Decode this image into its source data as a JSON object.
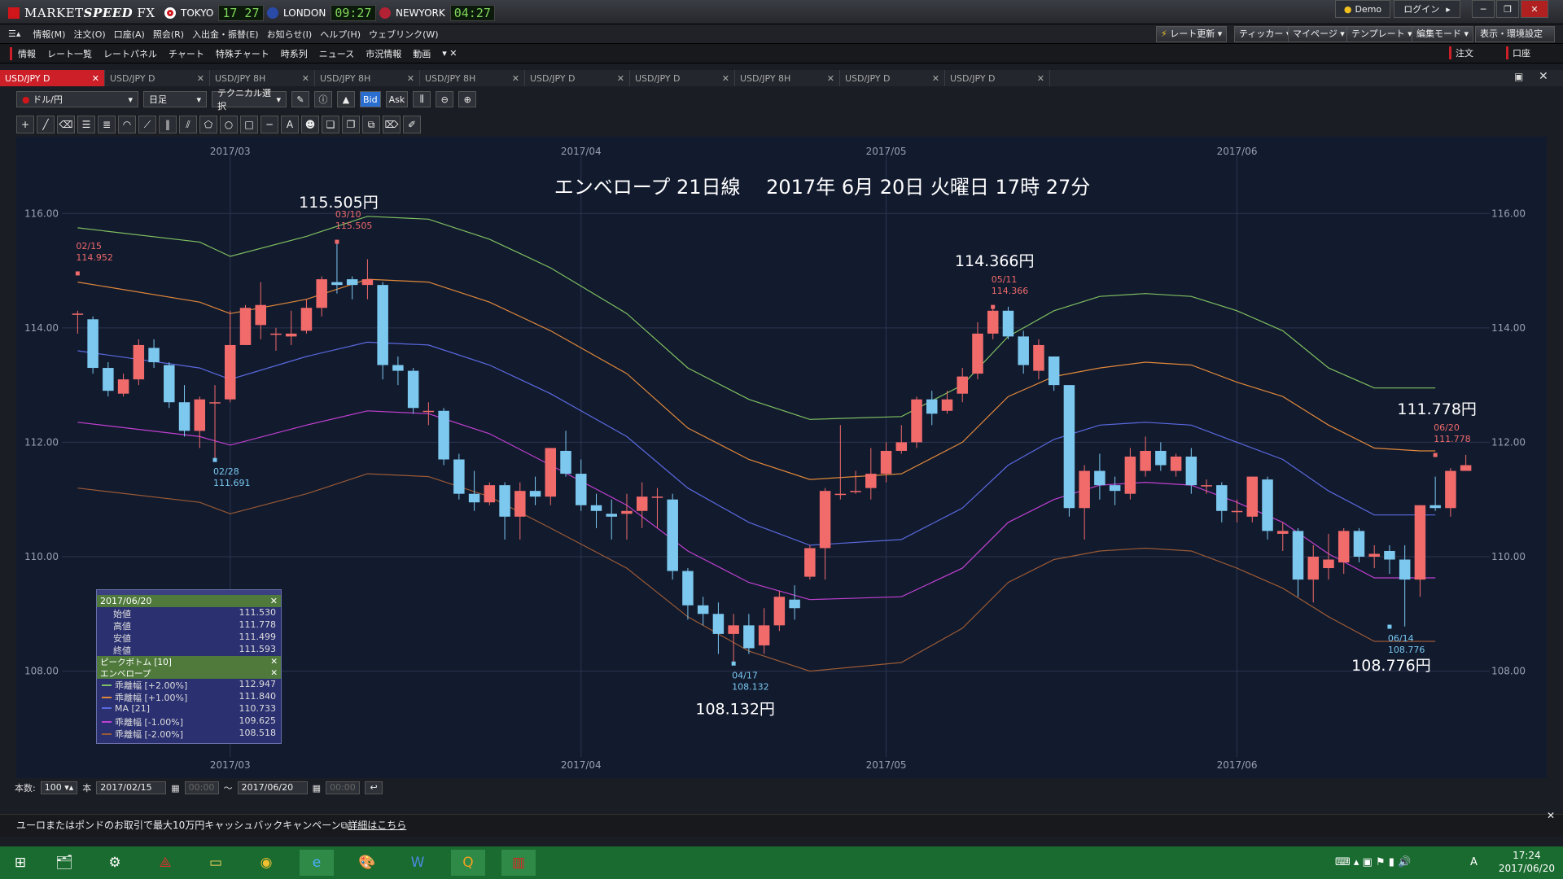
{
  "app": {
    "name_a": "MARKET",
    "name_b": "SPEED",
    "name_c": " FX"
  },
  "clocks": [
    {
      "city": "TOKYO",
      "time": "17 27",
      "flag": "#d0151b"
    },
    {
      "city": "LONDON",
      "time": "09:27",
      "flag": "#2a4aa8"
    },
    {
      "city": "NEWYORK",
      "time": "04:27",
      "flag": "#b22234"
    }
  ],
  "window": {
    "demo": "Demo",
    "login": "ログイン"
  },
  "menu": [
    "情報(M)",
    "注文(O)",
    "口座(A)",
    "照会(R)",
    "入出金・振替(E)",
    "お知らせ(I)",
    "ヘルプ(H)",
    "ウェブリンク(W)"
  ],
  "right_menu": [
    "レート更新",
    "ティッカー",
    "マイページ",
    "テンプレート",
    "編集モード",
    "表示・環境設定"
  ],
  "nav": [
    "情報",
    "レート一覧",
    "レートパネル",
    "チャート",
    "特殊チャート",
    "時系列",
    "ニュース",
    "市況情報",
    "動画"
  ],
  "nav_right": [
    "注文",
    "口座"
  ],
  "tabs": [
    "USD/JPY D",
    "USD/JPY D",
    "USD/JPY 8H",
    "USD/JPY 8H",
    "USD/JPY 8H",
    "USD/JPY D",
    "USD/JPY D",
    "USD/JPY 8H",
    "USD/JPY D",
    "USD/JPY D"
  ],
  "toolbar": {
    "pair": "ドル/円",
    "period": "日足",
    "tech": "テクニカル選択",
    "bid": "Bid",
    "ask": "Ask"
  },
  "chart_data": {
    "type": "candlestick",
    "title": "エンベロープ 21日線　 2017年 6月 20日 火曜日 17時 27分",
    "ylim": [
      106.5,
      117.0
    ],
    "yticks": [
      "116.00",
      "114.00",
      "112.00",
      "110.00",
      "108.00"
    ],
    "ytick_values": [
      116,
      114,
      112,
      110,
      108
    ],
    "month_labels": [
      {
        "label": "2017/03",
        "d": 10
      },
      {
        "label": "2017/04",
        "d": 33
      },
      {
        "label": "2017/05",
        "d": 53
      },
      {
        "label": "2017/06",
        "d": 76
      }
    ],
    "candles": [
      [
        114.25,
        114.25,
        114.3,
        113.9
      ],
      [
        114.15,
        113.3,
        114.2,
        113.2
      ],
      [
        113.3,
        112.9,
        113.4,
        112.8
      ],
      [
        112.85,
        113.1,
        113.2,
        112.8
      ],
      [
        113.1,
        113.7,
        113.8,
        113.0
      ],
      [
        113.65,
        113.4,
        113.8,
        113.3
      ],
      [
        113.35,
        112.7,
        113.4,
        112.6
      ],
      [
        112.7,
        112.2,
        113.0,
        112.1
      ],
      [
        112.2,
        112.75,
        112.8,
        111.9
      ],
      [
        112.7,
        112.7,
        113.0,
        111.7
      ],
      [
        112.75,
        113.7,
        114.3,
        112.7
      ],
      [
        113.7,
        114.35,
        114.4,
        113.7
      ],
      [
        114.05,
        114.4,
        114.8,
        113.8
      ],
      [
        113.9,
        113.9,
        114.0,
        113.6
      ],
      [
        113.85,
        113.9,
        114.3,
        113.7
      ],
      [
        113.95,
        114.35,
        114.5,
        113.9
      ],
      [
        114.35,
        114.85,
        114.9,
        114.2
      ],
      [
        114.8,
        114.75,
        115.5,
        114.6
      ],
      [
        114.85,
        114.75,
        114.9,
        114.5
      ],
      [
        114.75,
        114.85,
        115.2,
        114.5
      ],
      [
        114.75,
        113.35,
        114.8,
        113.1
      ],
      [
        113.35,
        113.25,
        113.5,
        113.0
      ],
      [
        113.25,
        112.6,
        113.3,
        112.5
      ],
      [
        112.55,
        112.55,
        112.7,
        112.3
      ],
      [
        112.55,
        111.7,
        112.6,
        111.6
      ],
      [
        111.7,
        111.1,
        111.8,
        111.0
      ],
      [
        111.1,
        110.95,
        111.5,
        110.8
      ],
      [
        110.95,
        111.25,
        111.3,
        110.9
      ],
      [
        111.25,
        110.7,
        111.3,
        110.3
      ],
      [
        110.7,
        111.15,
        111.3,
        110.3
      ],
      [
        111.15,
        111.05,
        111.4,
        110.9
      ],
      [
        111.05,
        111.9,
        111.9,
        110.9
      ],
      [
        111.85,
        111.45,
        112.2,
        111.4
      ],
      [
        111.45,
        110.9,
        111.7,
        110.8
      ],
      [
        110.9,
        110.8,
        111.1,
        110.5
      ],
      [
        110.75,
        110.7,
        111.0,
        110.3
      ],
      [
        110.75,
        110.8,
        111.1,
        110.3
      ],
      [
        110.8,
        111.05,
        111.3,
        110.5
      ],
      [
        111.05,
        111.05,
        111.2,
        110.5
      ],
      [
        111.0,
        109.75,
        111.1,
        109.6
      ],
      [
        109.75,
        109.15,
        109.8,
        108.9
      ],
      [
        109.15,
        109.0,
        109.3,
        108.8
      ],
      [
        109.0,
        108.65,
        109.2,
        108.3
      ],
      [
        108.65,
        108.8,
        109.0,
        108.13
      ],
      [
        108.8,
        108.4,
        109.0,
        108.3
      ],
      [
        108.45,
        108.8,
        109.1,
        108.3
      ],
      [
        108.8,
        109.3,
        109.4,
        108.7
      ],
      [
        109.25,
        109.1,
        109.5,
        108.9
      ],
      [
        109.65,
        110.15,
        110.2,
        109.6
      ],
      [
        110.15,
        111.15,
        111.2,
        109.6
      ],
      [
        111.1,
        111.1,
        112.3,
        111.0
      ],
      [
        111.15,
        111.15,
        111.5,
        111.1
      ],
      [
        111.2,
        111.45,
        111.9,
        111.0
      ],
      [
        111.45,
        111.85,
        112.0,
        111.3
      ],
      [
        111.85,
        112.0,
        112.3,
        111.8
      ],
      [
        112.0,
        112.75,
        112.8,
        111.9
      ],
      [
        112.75,
        112.5,
        112.9,
        112.3
      ],
      [
        112.55,
        112.75,
        112.9,
        112.5
      ],
      [
        112.85,
        113.15,
        113.3,
        112.7
      ],
      [
        113.2,
        113.9,
        114.1,
        113.1
      ],
      [
        113.9,
        114.3,
        114.37,
        113.8
      ],
      [
        114.3,
        113.85,
        114.37,
        113.8
      ],
      [
        113.85,
        113.35,
        113.95,
        113.2
      ],
      [
        113.25,
        113.7,
        113.8,
        113.1
      ],
      [
        113.5,
        113.0,
        113.5,
        112.9
      ],
      [
        113.0,
        110.85,
        113.0,
        110.7
      ],
      [
        110.85,
        111.5,
        111.6,
        110.3
      ],
      [
        111.5,
        111.25,
        111.8,
        111.0
      ],
      [
        111.25,
        111.15,
        111.4,
        110.9
      ],
      [
        111.1,
        111.75,
        111.9,
        111.0
      ],
      [
        111.5,
        111.85,
        112.1,
        111.4
      ],
      [
        111.85,
        111.6,
        112.0,
        111.5
      ],
      [
        111.5,
        111.75,
        111.8,
        111.4
      ],
      [
        111.75,
        111.25,
        111.9,
        111.1
      ],
      [
        111.25,
        111.25,
        111.35,
        111.1
      ],
      [
        111.25,
        110.8,
        111.3,
        110.6
      ],
      [
        110.8,
        110.8,
        111.0,
        110.6
      ],
      [
        110.7,
        111.4,
        111.4,
        110.6
      ],
      [
        111.35,
        110.45,
        111.4,
        110.3
      ],
      [
        110.4,
        110.45,
        110.6,
        110.1
      ],
      [
        110.45,
        109.6,
        110.5,
        109.3
      ],
      [
        109.6,
        110.0,
        110.2,
        109.2
      ],
      [
        109.8,
        109.95,
        110.4,
        109.6
      ],
      [
        109.9,
        110.45,
        110.5,
        109.7
      ],
      [
        110.45,
        110.0,
        110.5,
        109.9
      ],
      [
        110.0,
        110.05,
        110.2,
        109.8
      ],
      [
        110.1,
        109.95,
        110.2,
        109.7
      ],
      [
        109.95,
        109.6,
        110.2,
        108.78
      ],
      [
        109.6,
        110.9,
        110.9,
        109.3
      ],
      [
        110.9,
        110.85,
        111.4,
        110.8
      ],
      [
        110.85,
        111.5,
        111.55,
        110.7
      ],
      [
        111.5,
        111.6,
        111.78,
        111.5
      ]
    ],
    "envelopes": [
      {
        "name": "乖離幅 [+2.00%]",
        "color": "#7fc060",
        "pts": [
          [
            0,
            115.75
          ],
          [
            8,
            115.5
          ],
          [
            10,
            115.25
          ],
          [
            15,
            115.6
          ],
          [
            19,
            115.95
          ],
          [
            23,
            115.9
          ],
          [
            27,
            115.55
          ],
          [
            31,
            115.05
          ],
          [
            36,
            114.25
          ],
          [
            40,
            113.3
          ],
          [
            44,
            112.75
          ],
          [
            48,
            112.4
          ],
          [
            54,
            112.45
          ],
          [
            58,
            113.0
          ],
          [
            61,
            113.85
          ],
          [
            64,
            114.3
          ],
          [
            67,
            114.55
          ],
          [
            70,
            114.6
          ],
          [
            73,
            114.55
          ],
          [
            76,
            114.3
          ],
          [
            79,
            113.95
          ],
          [
            82,
            113.3
          ],
          [
            85,
            112.95
          ],
          [
            89,
            112.95
          ]
        ]
      },
      {
        "name": "乖離幅 [+1.00%]",
        "color": "#e0883a",
        "pts": [
          [
            0,
            114.8
          ],
          [
            8,
            114.45
          ],
          [
            10,
            114.25
          ],
          [
            15,
            114.5
          ],
          [
            19,
            114.85
          ],
          [
            23,
            114.8
          ],
          [
            27,
            114.45
          ],
          [
            31,
            113.95
          ],
          [
            36,
            113.2
          ],
          [
            40,
            112.25
          ],
          [
            44,
            111.7
          ],
          [
            48,
            111.35
          ],
          [
            54,
            111.45
          ],
          [
            58,
            112.0
          ],
          [
            61,
            112.8
          ],
          [
            64,
            113.15
          ],
          [
            67,
            113.3
          ],
          [
            70,
            113.4
          ],
          [
            73,
            113.35
          ],
          [
            76,
            113.05
          ],
          [
            79,
            112.8
          ],
          [
            82,
            112.3
          ],
          [
            85,
            111.9
          ],
          [
            88,
            111.85
          ],
          [
            89,
            111.85
          ]
        ]
      },
      {
        "name": "MA [21]",
        "color": "#5a6adf",
        "pts": [
          [
            0,
            113.6
          ],
          [
            8,
            113.3
          ],
          [
            10,
            113.1
          ],
          [
            15,
            113.5
          ],
          [
            19,
            113.75
          ],
          [
            23,
            113.7
          ],
          [
            27,
            113.35
          ],
          [
            31,
            112.85
          ],
          [
            36,
            112.1
          ],
          [
            40,
            111.2
          ],
          [
            44,
            110.6
          ],
          [
            48,
            110.2
          ],
          [
            54,
            110.3
          ],
          [
            58,
            110.85
          ],
          [
            61,
            111.6
          ],
          [
            64,
            112.05
          ],
          [
            67,
            112.3
          ],
          [
            70,
            112.35
          ],
          [
            73,
            112.3
          ],
          [
            76,
            112.0
          ],
          [
            79,
            111.7
          ],
          [
            82,
            111.15
          ],
          [
            85,
            110.73
          ],
          [
            89,
            110.73
          ]
        ]
      },
      {
        "name": "乖離幅 [-1.00%]",
        "color": "#c040d0",
        "pts": [
          [
            0,
            112.35
          ],
          [
            8,
            112.1
          ],
          [
            10,
            111.95
          ],
          [
            15,
            112.3
          ],
          [
            19,
            112.55
          ],
          [
            23,
            112.5
          ],
          [
            27,
            112.15
          ],
          [
            31,
            111.6
          ],
          [
            36,
            110.9
          ],
          [
            40,
            110.1
          ],
          [
            44,
            109.55
          ],
          [
            48,
            109.25
          ],
          [
            54,
            109.3
          ],
          [
            58,
            109.8
          ],
          [
            61,
            110.6
          ],
          [
            64,
            111.0
          ],
          [
            67,
            111.25
          ],
          [
            70,
            111.3
          ],
          [
            73,
            111.25
          ],
          [
            76,
            110.95
          ],
          [
            79,
            110.6
          ],
          [
            82,
            110.05
          ],
          [
            85,
            109.63
          ],
          [
            89,
            109.63
          ]
        ]
      },
      {
        "name": "乖離幅 [-2.00%]",
        "color": "#9a5a34",
        "pts": [
          [
            0,
            111.2
          ],
          [
            8,
            110.95
          ],
          [
            10,
            110.75
          ],
          [
            15,
            111.1
          ],
          [
            19,
            111.45
          ],
          [
            23,
            111.4
          ],
          [
            27,
            111.05
          ],
          [
            31,
            110.5
          ],
          [
            36,
            109.8
          ],
          [
            40,
            108.95
          ],
          [
            44,
            108.35
          ],
          [
            48,
            108.0
          ],
          [
            54,
            108.15
          ],
          [
            58,
            108.75
          ],
          [
            61,
            109.55
          ],
          [
            64,
            109.95
          ],
          [
            67,
            110.1
          ],
          [
            70,
            110.15
          ],
          [
            73,
            110.1
          ],
          [
            76,
            109.8
          ],
          [
            79,
            109.45
          ],
          [
            82,
            108.95
          ],
          [
            85,
            108.52
          ],
          [
            89,
            108.52
          ]
        ]
      }
    ],
    "markers": [
      {
        "i": 0,
        "date": "02/15",
        "price": "114.952",
        "v": 114.952,
        "pos": "above",
        "color": "#ef6a6a"
      },
      {
        "i": 9,
        "date": "02/28",
        "price": "111.691",
        "v": 111.691,
        "pos": "below",
        "color": "#78c8f0"
      },
      {
        "i": 17,
        "date": "03/10",
        "price": "115.505",
        "v": 115.505,
        "pos": "above",
        "color": "#ef6a6a"
      },
      {
        "i": 43,
        "date": "04/17",
        "price": "108.132",
        "v": 108.132,
        "pos": "below",
        "color": "#78c8f0"
      },
      {
        "i": 60,
        "date": "05/11",
        "price": "114.366",
        "v": 114.366,
        "pos": "above",
        "color": "#ef6a6a"
      },
      {
        "i": 86,
        "date": "06/14",
        "price": "108.776",
        "v": 108.776,
        "pos": "below",
        "color": "#78c8f0"
      },
      {
        "i": 89,
        "date": "06/20",
        "price": "111.778",
        "v": 111.778,
        "pos": "above",
        "color": "#ef6a6a"
      }
    ],
    "big_labels": [
      {
        "text": "115.505円",
        "i": 17,
        "v": 115.505,
        "pos": "above"
      },
      {
        "text": "114.366円",
        "i": 60,
        "v": 114.366,
        "pos": "above2"
      },
      {
        "text": "111.778円",
        "i": 89,
        "v": 111.778,
        "pos": "above2"
      },
      {
        "text": "108.776円",
        "i": 86,
        "v": 108.776,
        "pos": "below"
      },
      {
        "text": "108.132円",
        "i": 43,
        "v": 108.132,
        "pos": "below2"
      }
    ]
  },
  "infobox": {
    "date": "2017/06/20",
    "ohlc": [
      {
        "k": "始値",
        "v": "111.530"
      },
      {
        "k": "高値",
        "v": "111.778"
      },
      {
        "k": "安値",
        "v": "111.499"
      },
      {
        "k": "終値",
        "v": "111.593"
      }
    ],
    "peak": "ピークボトム [10]",
    "env": "エンベロープ",
    "lines": [
      {
        "k": "乖離幅 [+2.00%]",
        "v": "112.947",
        "c": "#7fc060"
      },
      {
        "k": "乖離幅 [+1.00%]",
        "v": "111.840",
        "c": "#e0883a"
      },
      {
        "k": "MA [21]",
        "v": "110.733",
        "c": "#5a6adf"
      },
      {
        "k": "乖離幅 [-1.00%]",
        "v": "109.625",
        "c": "#c040d0"
      },
      {
        "k": "乖離幅 [-2.00%]",
        "v": "108.518",
        "c": "#9a5a34"
      }
    ]
  },
  "bottom": {
    "count_label": "本数:",
    "count": "100",
    "unit": "本",
    "from": "2017/02/15",
    "from_time": "00:00",
    "tilde": "～",
    "to": "2017/06/20",
    "to_time": "00:00"
  },
  "status": "ユーロまたはポンドのお取引で最大10万円キャッシュバックキャンペーン",
  "status_link": "詳細はこちら",
  "tray": {
    "time": "17:24",
    "date": "2017/06/20",
    "ime": "A"
  }
}
